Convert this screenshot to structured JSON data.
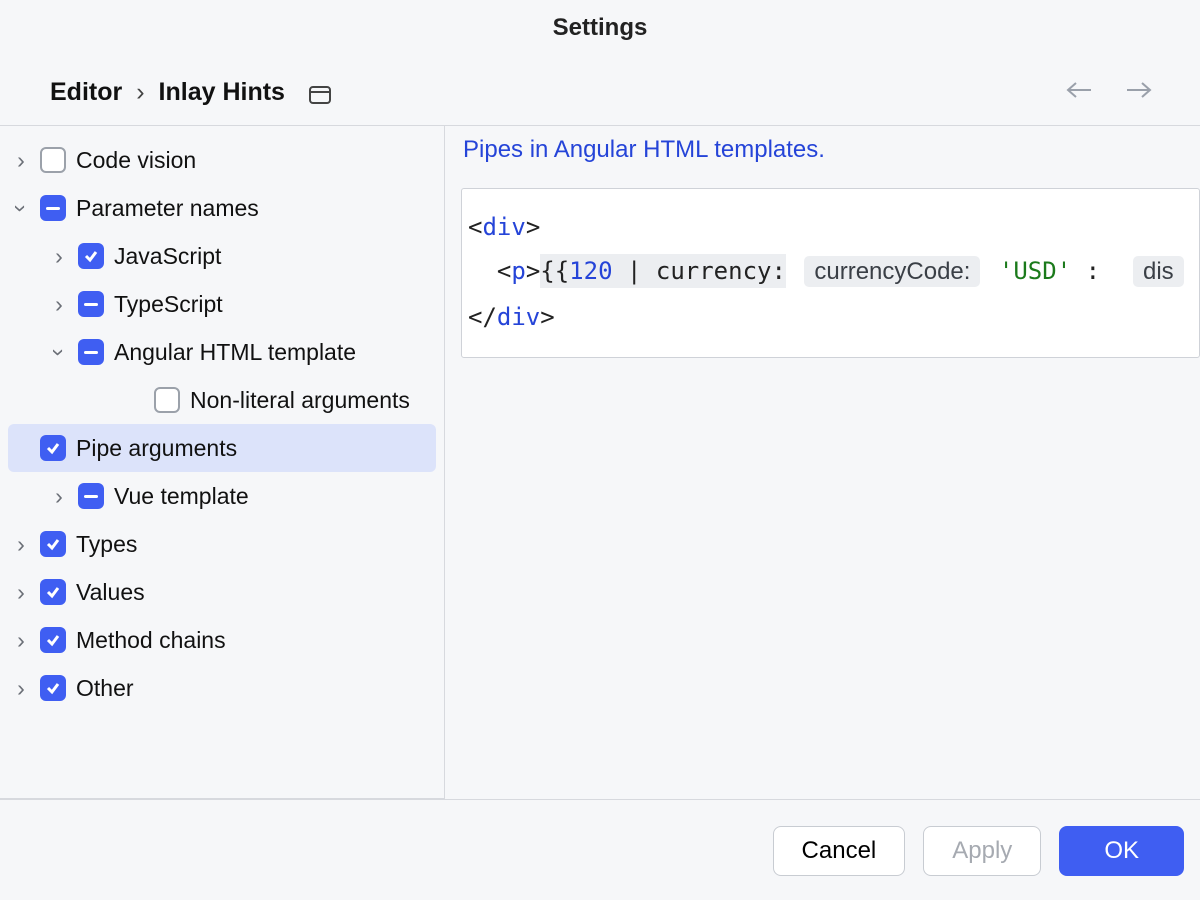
{
  "title": "Settings",
  "breadcrumb": {
    "root": "Editor",
    "current": "Inlay Hints"
  },
  "tree": {
    "code_vision": "Code vision",
    "parameter_names": "Parameter names",
    "javascript": "JavaScript",
    "typescript": "TypeScript",
    "angular_html_template": "Angular HTML template",
    "non_literal_arguments": "Non-literal arguments",
    "pipe_arguments": "Pipe arguments",
    "vue_template": "Vue template",
    "types": "Types",
    "values": "Values",
    "method_chains": "Method chains",
    "other": "Other"
  },
  "main": {
    "description": "Pipes in Angular HTML templates.",
    "code": {
      "tag_div": "div",
      "tag_p": "p",
      "number": "120",
      "pipe_text": " | currency:",
      "hint1": "currencyCode:",
      "str1": "'USD'",
      "colon": " :",
      "hint2": "dis"
    }
  },
  "footer": {
    "cancel": "Cancel",
    "apply": "Apply",
    "ok": "OK"
  }
}
